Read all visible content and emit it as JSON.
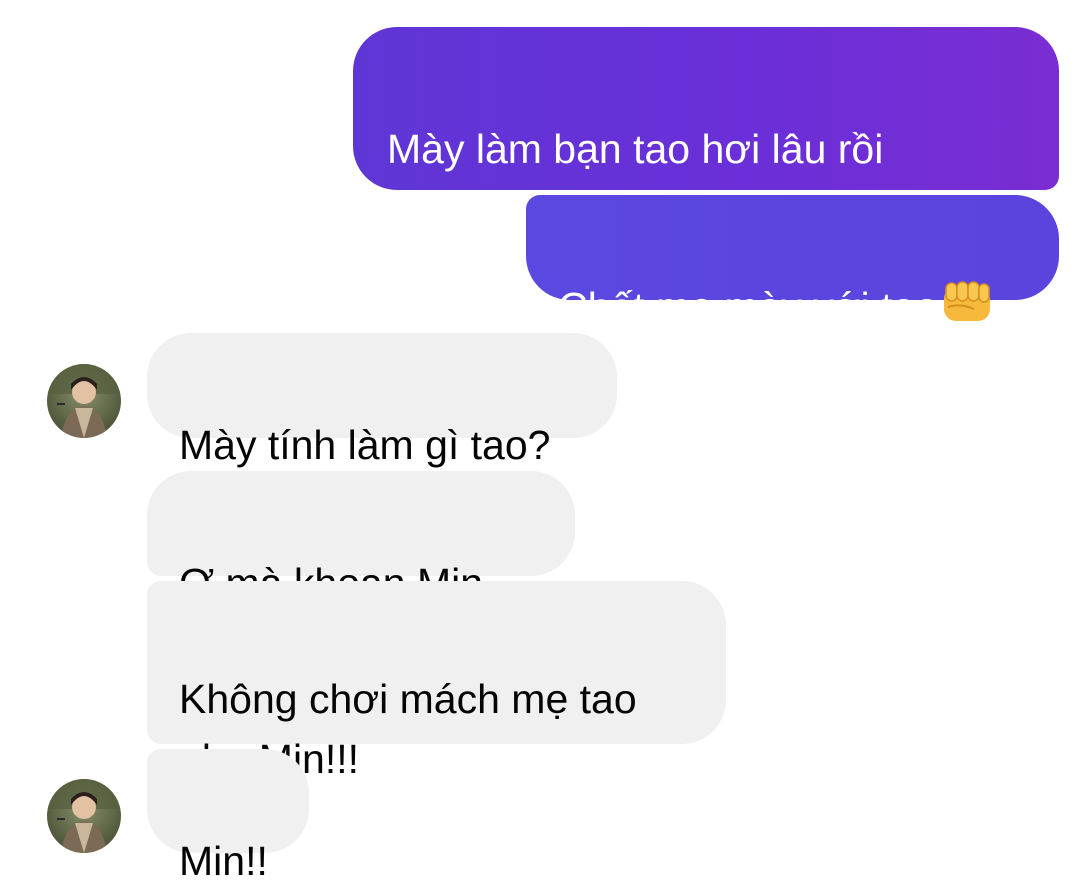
{
  "messages": {
    "out_1": "Mày làm bạn tao hơi lâu rồi\nđấy Taehyung",
    "out_2": "Chết mẹ mày với tao",
    "out_2_emoji": "fist-emoji",
    "in_1": "Mày tính làm gì tao?",
    "in_2": "Ơ mà khoan Min...",
    "in_3": "Không chơi mách mẹ tao\nnha Min!!!",
    "in_4": "Min!!"
  },
  "colors": {
    "outgoing_start": "#5f36d6",
    "outgoing_end": "#7a2dd2",
    "incoming": "#f0f0f0",
    "background": "#ffffff"
  }
}
